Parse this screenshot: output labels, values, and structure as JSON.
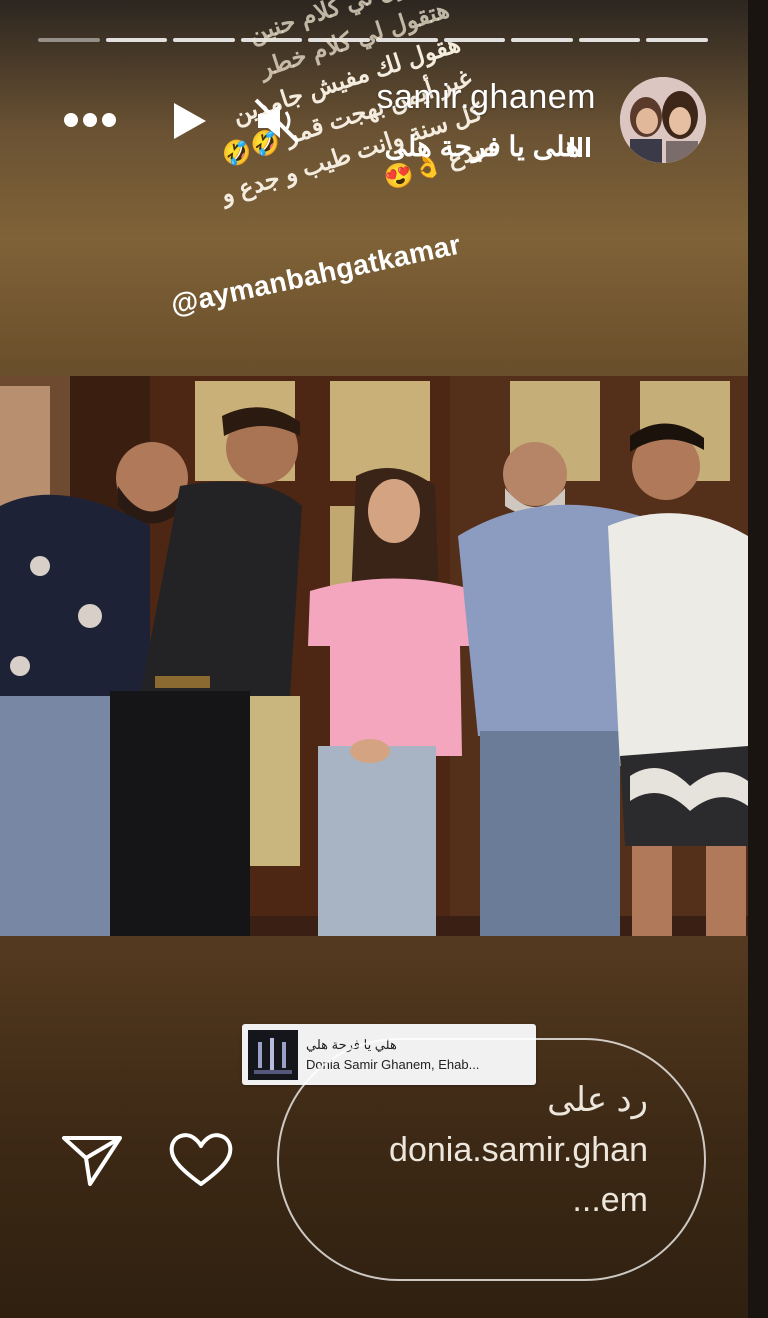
{
  "story": {
    "progress_segments": 10,
    "active_segment": 1
  },
  "header": {
    "username": "samir.ghanem",
    "subtitle": "هلى يا فرحة هلى"
  },
  "caption": {
    "lines": [
      "هتقول لي كلام حنين",
      "هتقول لي كلام خطر",
      "هقول لك مفيش جامدين",
      "غير أيمن بهجت قمر 🤣🤣",
      "كل سنة وانت طيب و جدع و",
      "مبدع 👌😍"
    ],
    "mention": "@aymanbahgatkamar"
  },
  "music": {
    "title": "هلي يا فرحة هلي",
    "artist": "Donia Samir Ghanem, Ehab..."
  },
  "reply": {
    "line1": "رد على",
    "line2": "donia.samir.ghan",
    "line3": "...em"
  },
  "icons": {
    "more": "more-icon",
    "play": "play-icon",
    "mute": "mute-icon",
    "send": "send-icon",
    "heart": "heart-icon",
    "equalizer": "equalizer-icon"
  },
  "colors": {
    "accent_pink": "#f4a6bf",
    "background_brown": "#6a4f2c"
  }
}
